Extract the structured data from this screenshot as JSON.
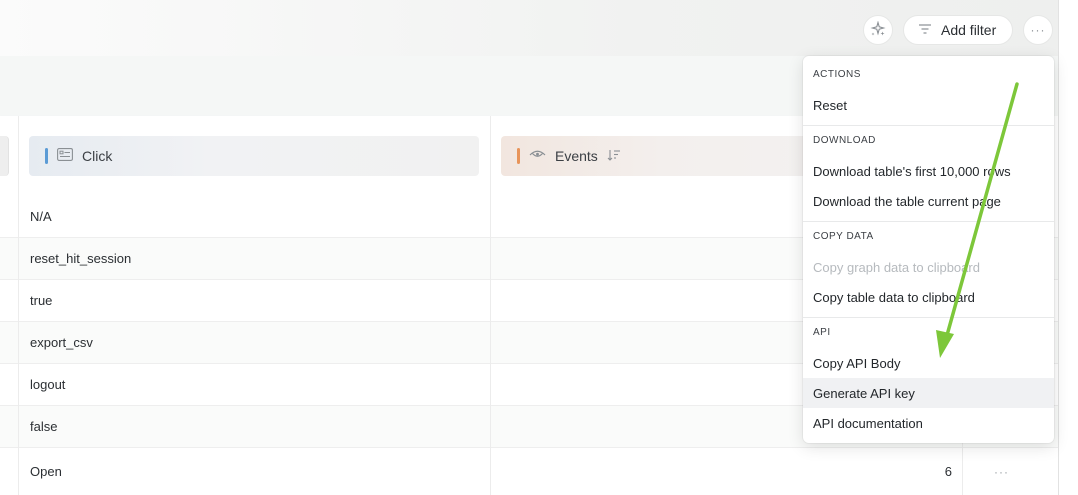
{
  "toolbar": {
    "magic_icon": "sparkle-icon",
    "filter_label": "Add filter",
    "filter_icon": "filter-lines-icon",
    "more_label": "···"
  },
  "columns": {
    "click": {
      "label": "Click",
      "icon": "list-card-icon",
      "accent": "#5b9bd5"
    },
    "events": {
      "label": "Events",
      "icon": "eye-icon",
      "sort_icon": "sort-desc-icon",
      "accent": "#e8945a"
    }
  },
  "rows": [
    {
      "label": "N/A",
      "value": ""
    },
    {
      "label": "reset_hit_session",
      "value": ""
    },
    {
      "label": "true",
      "value": ""
    },
    {
      "label": "export_csv",
      "value": ""
    },
    {
      "label": "logout",
      "value": ""
    },
    {
      "label": "false",
      "value": ""
    },
    {
      "label": "Open",
      "value": "6",
      "more": "···"
    }
  ],
  "menu": {
    "actions": {
      "title": "ACTIONS",
      "items": [
        "Reset"
      ]
    },
    "download": {
      "title": "DOWNLOAD",
      "items": [
        "Download table's first 10,000 rows",
        "Download the table current page"
      ]
    },
    "copy_data": {
      "title": "COPY DATA",
      "items": [
        "Copy graph data to clipboard",
        "Copy table data to clipboard"
      ]
    },
    "api": {
      "title": "API",
      "items": [
        "Copy API Body",
        "Generate API key",
        "API documentation"
      ]
    }
  },
  "annotation": {
    "arrow_color": "#7dc73a"
  }
}
